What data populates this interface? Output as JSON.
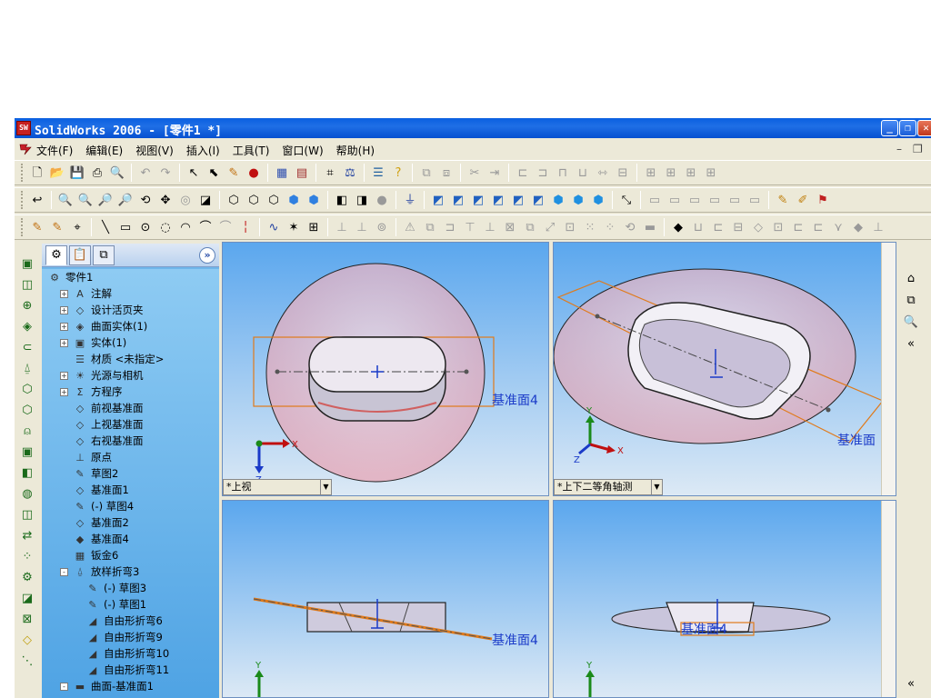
{
  "window": {
    "title": "SolidWorks 2006 - [零件1 *]",
    "buttons": {
      "minimize": "_",
      "restore": "❐",
      "close": "✕"
    }
  },
  "menubar": {
    "items": [
      "文件(F)",
      "编辑(E)",
      "视图(V)",
      "插入(I)",
      "工具(T)",
      "窗口(W)",
      "帮助(H)"
    ],
    "mdi_min": "–",
    "mdi_restore": "❐"
  },
  "feature_manager": {
    "collapse_label": "»",
    "tree": [
      {
        "label": "零件1",
        "icon": "part-icon",
        "indent": 0,
        "expander": ""
      },
      {
        "label": "注解",
        "icon": "annotations-icon",
        "indent": 1,
        "expander": "+"
      },
      {
        "label": "设计活页夹",
        "icon": "design-binder-icon",
        "indent": 1,
        "expander": "+"
      },
      {
        "label": "曲面实体(1)",
        "icon": "surface-bodies-icon",
        "indent": 1,
        "expander": "+"
      },
      {
        "label": "实体(1)",
        "icon": "solid-bodies-icon",
        "indent": 1,
        "expander": "+"
      },
      {
        "label": "材质 <未指定>",
        "icon": "material-icon",
        "indent": 1,
        "expander": ""
      },
      {
        "label": "光源与相机",
        "icon": "lights-icon",
        "indent": 1,
        "expander": "+"
      },
      {
        "label": "方程序",
        "icon": "equations-icon",
        "indent": 1,
        "expander": "+"
      },
      {
        "label": "前视基准面",
        "icon": "plane-icon",
        "indent": 1,
        "expander": ""
      },
      {
        "label": "上视基准面",
        "icon": "plane-icon",
        "indent": 1,
        "expander": ""
      },
      {
        "label": "右视基准面",
        "icon": "plane-icon",
        "indent": 1,
        "expander": ""
      },
      {
        "label": "原点",
        "icon": "origin-icon",
        "indent": 1,
        "expander": ""
      },
      {
        "label": "草图2",
        "icon": "sketch-icon",
        "indent": 1,
        "expander": ""
      },
      {
        "label": "基准面1",
        "icon": "plane-icon",
        "indent": 1,
        "expander": ""
      },
      {
        "label": "(-) 草图4",
        "icon": "sketch-icon",
        "indent": 1,
        "expander": ""
      },
      {
        "label": "基准面2",
        "icon": "plane-icon",
        "indent": 1,
        "expander": ""
      },
      {
        "label": "基准面4",
        "icon": "plane-selected-icon",
        "indent": 1,
        "expander": ""
      },
      {
        "label": "钣金6",
        "icon": "sheetmetal-icon",
        "indent": 1,
        "expander": ""
      },
      {
        "label": "放样折弯3",
        "icon": "lofted-bend-icon",
        "indent": 1,
        "expander": "-"
      },
      {
        "label": "(-) 草图3",
        "icon": "sketch-icon",
        "indent": 2,
        "expander": ""
      },
      {
        "label": "(-) 草图1",
        "icon": "sketch-icon",
        "indent": 2,
        "expander": ""
      },
      {
        "label": "自由形折弯6",
        "icon": "bend-icon",
        "indent": 2,
        "expander": ""
      },
      {
        "label": "自由形折弯9",
        "icon": "bend-icon",
        "indent": 2,
        "expander": ""
      },
      {
        "label": "自由形折弯10",
        "icon": "bend-icon",
        "indent": 2,
        "expander": ""
      },
      {
        "label": "自由形折弯11",
        "icon": "bend-icon",
        "indent": 2,
        "expander": ""
      },
      {
        "label": "曲面-基准面1",
        "icon": "surface-plane-icon",
        "indent": 1,
        "expander": "-"
      }
    ]
  },
  "viewports": {
    "top_left": {
      "orientation": "*上视",
      "plane_label": "基准面4",
      "triad_x": "X",
      "triad_z": "Z"
    },
    "top_right": {
      "orientation": "*上下二等角轴测",
      "plane_label": "基准面",
      "triad_x": "X",
      "triad_y": "Y",
      "triad_z": "Z"
    },
    "bottom_left": {
      "plane_label": "基准面4",
      "triad_y": "Y"
    },
    "bottom_right": {
      "plane_label": "基准面4",
      "triad_y": "Y"
    }
  },
  "colors": {
    "title_bar": "#0a5fe0",
    "viewport_top": "#5ba7ee",
    "plane_edge": "#e07a1a",
    "label_blue": "#1a3ac8",
    "tree_bg": "#6fb6ea"
  }
}
